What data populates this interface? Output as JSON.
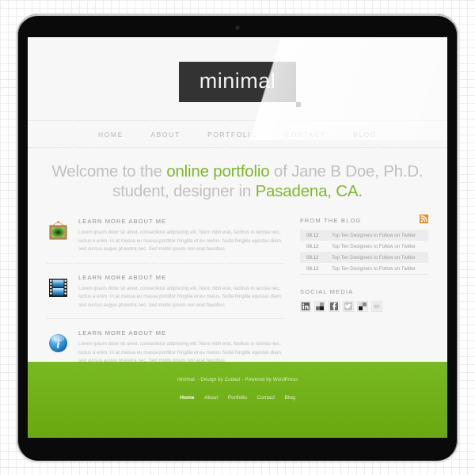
{
  "site": {
    "logo": "minimal",
    "nav": [
      {
        "label": "HOME"
      },
      {
        "label": "ABOUT"
      },
      {
        "label": "PORTFOLIO"
      },
      {
        "label": "CONTACT"
      },
      {
        "label": "BLOG"
      }
    ],
    "headline": {
      "part1": "Welcome to the ",
      "highlight1": "online portfolio",
      "part2": " of Jane B Doe, Ph.D. student, designer in ",
      "highlight2": "Pasadena, CA.",
      "accent_color": "#7fb82a"
    },
    "features": [
      {
        "icon": "picture-frame-icon",
        "title": "LEARN MORE ABOUT ME",
        "text": "Lorem ipsum dolor sit amet, consectetur adipiscing elit. Nunc nibh erat, facilisis in lacinia nec, luctus a enim. In at massa eu massa porttitor fringilla et eu metus. Nulla fringilla egestas diam, sed cursus augue pharetra nec. Sed mollis ipsum non erat faucibus"
      },
      {
        "icon": "film-strip-icon",
        "title": "LEARN MORE ABOUT ME",
        "text": "Lorem ipsum dolor sit amet, consectetur adipiscing elit. Nunc nibh erat, facilisis in lacinia nec, luctus a enim. In at massa eu massa porttitor fringilla et eu metus. Nulla fringilla egestas diam, sed cursus augue pharetra nec. Sed mollis ipsum non erat faucibus"
      },
      {
        "icon": "info-circle-icon",
        "title": "LEARN MORE ABOUT ME",
        "text": "Lorem ipsum dolor sit amet, consectetur adipiscing elit. Nunc nibh erat, facilisis in lacinia nec, luctus a enim. In at massa eu massa porttitor fringilla et eu metus. Nulla fringilla egestas diam, sed cursus augue pharetra nec. Sed mollis ipsum non erat faucibus"
      }
    ],
    "sidebar": {
      "blog_title": "FROM THE BLOG",
      "rss_color": "#f0932a",
      "posts": [
        {
          "date": "08.12",
          "title": "Top Ten Designers to Follow on Twitter"
        },
        {
          "date": "08.12",
          "title": "Top Ten Designers to Follow on Twitter"
        },
        {
          "date": "08.12",
          "title": "Top Ten Designers to Follow on Twitter"
        },
        {
          "date": "08.12",
          "title": "Top Ten Designers to Follow on Twitter"
        }
      ],
      "social_title": "SOCIAL MEDIA",
      "social": [
        {
          "name": "linkedin-icon",
          "glyph": "in"
        },
        {
          "name": "delicious-icon",
          "glyph": ""
        },
        {
          "name": "facebook-icon",
          "glyph": "f"
        },
        {
          "name": "twitter-icon",
          "glyph": "t"
        },
        {
          "name": "checker-icon",
          "glyph": ""
        },
        {
          "name": "flickr-icon",
          "glyph": ""
        }
      ]
    },
    "footer": {
      "credit": "minimal. - Design by Cudazi - Powered by WordPress",
      "nav": [
        {
          "label": "Home",
          "active": true
        },
        {
          "label": "About",
          "active": false
        },
        {
          "label": "Portfolio",
          "active": false
        },
        {
          "label": "Contact",
          "active": false
        },
        {
          "label": "Blog",
          "active": false
        }
      ]
    }
  }
}
